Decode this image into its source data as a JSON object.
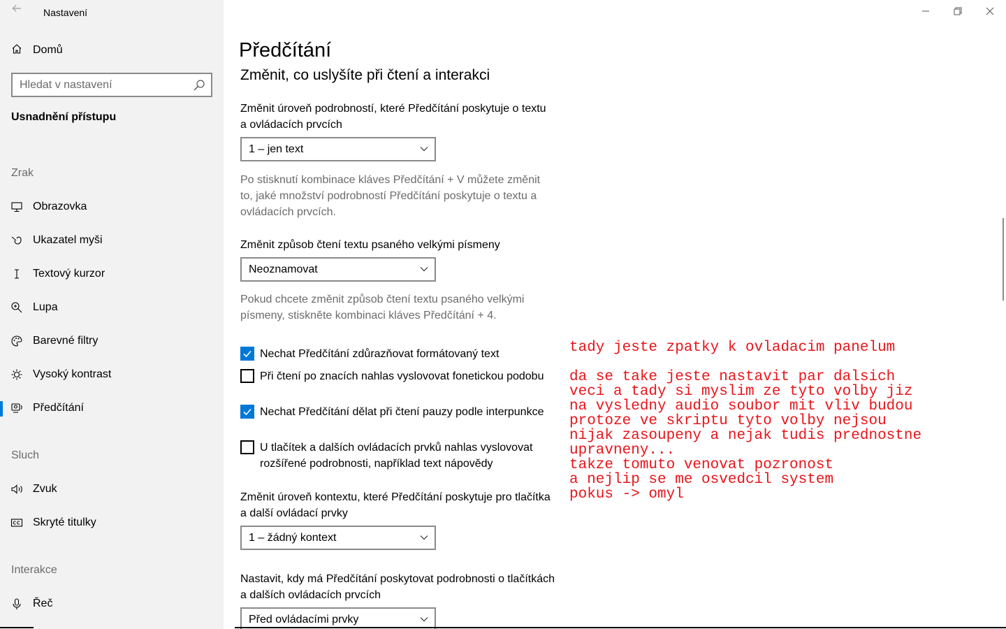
{
  "window": {
    "app_title": "Nastavení",
    "controls": [
      "minimize-icon",
      "restore-icon",
      "close-icon"
    ]
  },
  "sidebar": {
    "home_label": "Domů",
    "search_placeholder": "Hledat v nastavení",
    "section_title": "Usnadnění přístupu",
    "groups": {
      "vision": "Zrak",
      "hearing": "Sluch",
      "interaction": "Interakce"
    },
    "items": [
      {
        "label": "Obrazovka",
        "icon": "display-icon"
      },
      {
        "label": "Ukazatel myši",
        "icon": "mouse-pointer-icon"
      },
      {
        "label": "Textový kurzor",
        "icon": "text-cursor-icon"
      },
      {
        "label": "Lupa",
        "icon": "magnifier-icon"
      },
      {
        "label": "Barevné filtry",
        "icon": "color-filters-icon"
      },
      {
        "label": "Vysoký kontrast",
        "icon": "high-contrast-icon"
      },
      {
        "label": "Předčítání",
        "icon": "narrator-icon",
        "active": true
      },
      {
        "label": "Zvuk",
        "icon": "speaker-icon"
      },
      {
        "label": "Skryté titulky",
        "icon": "closed-captions-icon"
      },
      {
        "label": "Řeč",
        "icon": "microphone-icon"
      }
    ]
  },
  "main": {
    "title": "Předčítání",
    "subtitle": "Změnit, co uslyšíte při čtení a interakci",
    "verbosity": {
      "label": "Změnit úroveň podrobností, které Předčítání poskytuje o textu a ovládacích prvcích",
      "value": "1 – jen text",
      "description": "Po stisknutí kombinace kláves Předčítání + V můžete změnit to, jaké množství podrobností Předčítání poskytuje o textu a ovládacích prvcích."
    },
    "capitals": {
      "label": "Změnit způsob čtení textu psaného velkými písmeny",
      "value": "Neoznamovat",
      "description": "Pokud chcete změnit způsob čtení textu psaného velkými písmeny, stiskněte kombinaci kláves Předčítání + 4."
    },
    "checkboxes": [
      {
        "label": "Nechat Předčítání zdůrazňovat formátovaný text",
        "checked": true
      },
      {
        "label": "Při čtení po znacích nahlas vyslovovat fonetickou podobu",
        "checked": false
      },
      {
        "label": "Nechat Předčítání dělat při čtení pauzy podle interpunkce",
        "checked": true
      },
      {
        "label": "U tlačítek a dalších ovládacích prvků nahlas vyslovovat rozšířené podrobnosti, například text nápovědy",
        "checked": false
      }
    ],
    "context": {
      "label": "Změnit úroveň kontextu, které Předčítání poskytuje pro tlačítka a další ovládací prvky",
      "value": "1 – žádný kontext"
    },
    "details_timing": {
      "label": "Nastavit, kdy má Předčítání poskytovat podrobnosti o tlačítkách a dalších ovládacích prvcích",
      "value": "Před ovládacími prvky"
    }
  },
  "annotation": {
    "text": "tady jeste zpatky k ovladacim panelum\n\nda se take jeste nastavit par dalsich\nveci a tady si myslim ze tyto volby jiz\nna vysledny audio soubor mit vliv budou\nprotoze ve skriptu tyto volby nejsou\nnijak zasoupeny a nejak tudis prednostne\nupravneny...\ntakze tomuto venovat pozronost\na nejlip se me osvedcil system\npokus -> omyl",
    "color": "#e8151b"
  },
  "colors": {
    "accent": "#0078d7",
    "sidebar_bg": "#f2f2f2",
    "muted_text": "#6b6b6b"
  }
}
